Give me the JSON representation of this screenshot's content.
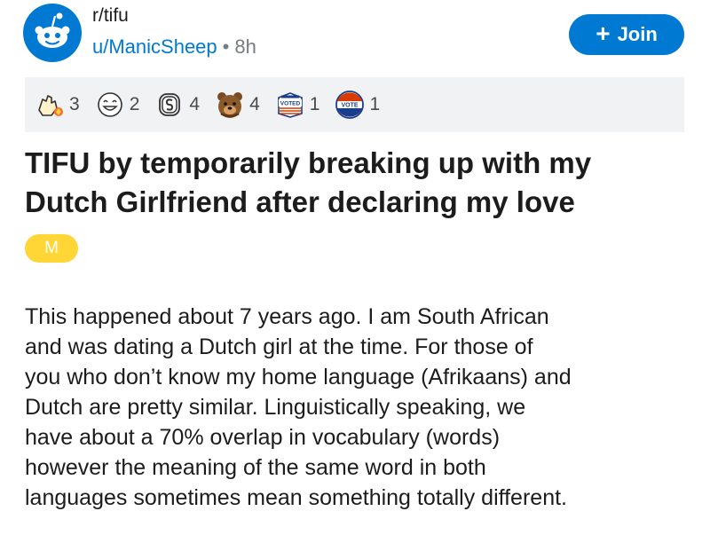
{
  "post": {
    "subreddit": "r/tifu",
    "author": "u/ManicSheep",
    "separator": "•",
    "age": "8h",
    "join_label": "Join",
    "awards": [
      {
        "icon": "facepalm-award-icon",
        "count": "3"
      },
      {
        "icon": "laughing-face-award-icon",
        "count": "2"
      },
      {
        "icon": "coin-award-icon",
        "count": "4"
      },
      {
        "icon": "bear-hug-award-icon",
        "count": "4"
      },
      {
        "icon": "voted-award-icon",
        "count": "1"
      },
      {
        "icon": "vote-award-icon",
        "count": "1"
      }
    ],
    "title_line1": "TIFU by temporarily breaking up with my",
    "title_line2": "Dutch Girlfriend after declaring my love",
    "flair": "M",
    "body_lines": [
      "This happened about 7 years ago. I am South African",
      "and was dating a Dutch girl at the time. For those of",
      "you who don’t know my home language (Afrikaans) and",
      "Dutch are pretty similar. Linguistically speaking, we",
      "have about a 70% overlap in vocabulary (words)",
      "however the meaning of the same word in both",
      "languages sometimes mean something totally different."
    ]
  },
  "colors": {
    "accent": "#0079d3",
    "flair": "#ffd635",
    "awards_bg": "#f1f2f4",
    "meta_gray": "#787c7e"
  }
}
